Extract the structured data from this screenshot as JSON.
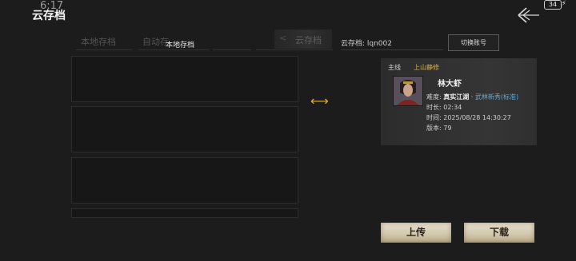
{
  "status_bar": {
    "time": "6:17",
    "battery": "34"
  },
  "header": {
    "title": "云存档"
  },
  "tabs": {
    "local_ghost": "本地存档",
    "auto_ghost": "自动存",
    "local_active": "本地存档",
    "cloud": "云存档"
  },
  "account": {
    "cloud_id_label": "云存档: lqn002",
    "switch_button": "切换账号"
  },
  "save_card": {
    "main_line": "主线",
    "chapter": "上山静修",
    "name": "林大虾",
    "difficulty_label": "难度:",
    "difficulty_value": "真实江湖",
    "difficulty_sep": " · ",
    "difficulty_mode": "武林新秀(标准)",
    "duration": "时长: 02:34",
    "timestamp": "时间: 2025/08/28 14:30:27",
    "version": "版本: 79"
  },
  "actions": {
    "upload": "上传",
    "download": "下载"
  },
  "colors": {
    "accent": "#d6a43e",
    "chapter": "#d9b04a",
    "mode": "#6fa6c8"
  },
  "icons": [
    "back-arrow-icon",
    "battery-icon",
    "transfer-icon"
  ]
}
